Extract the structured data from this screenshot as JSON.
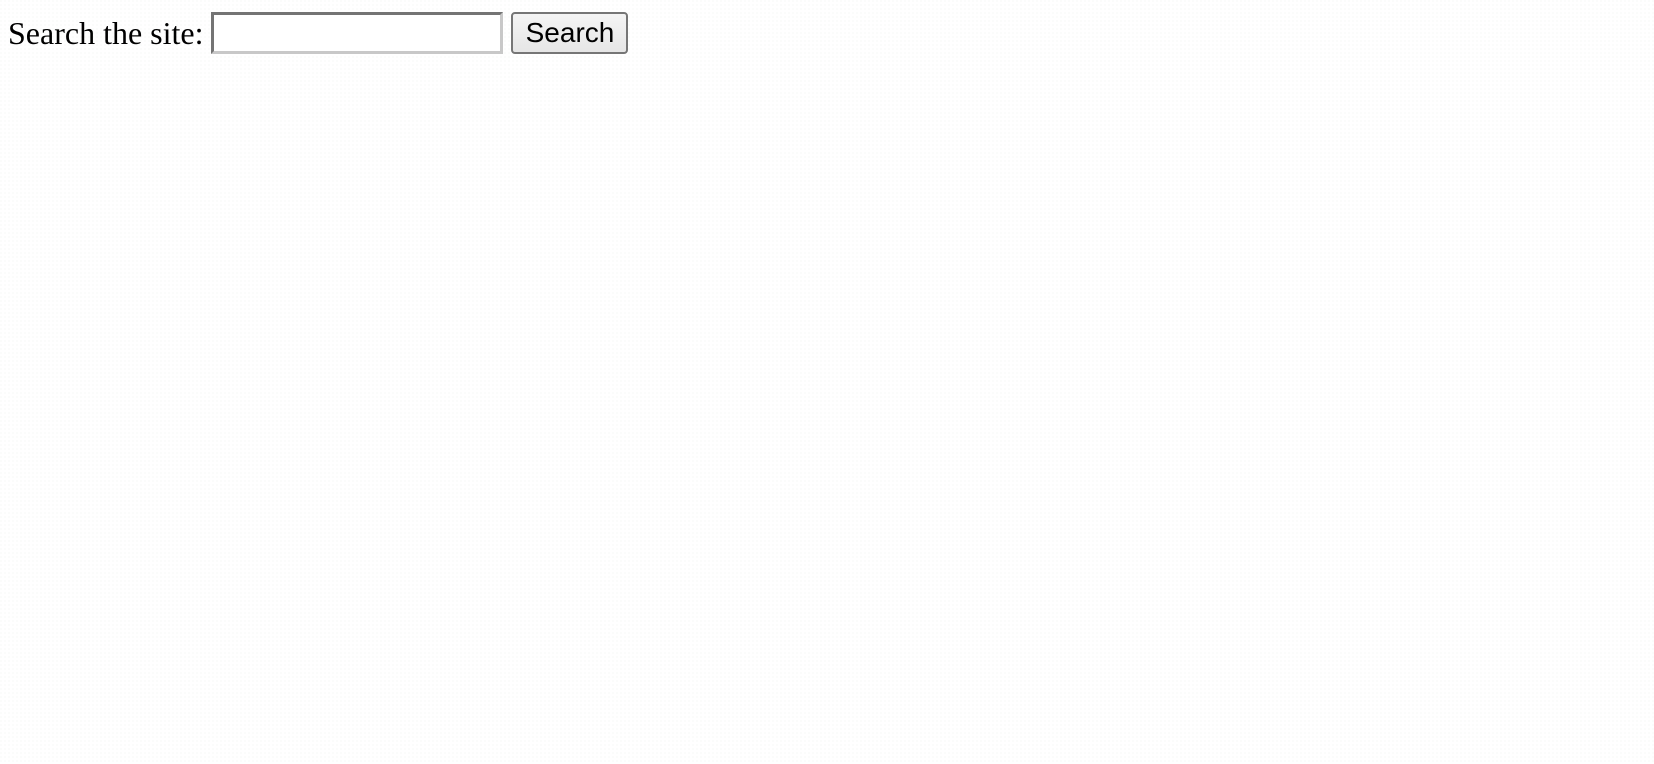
{
  "search": {
    "label": "Search the site:",
    "value": "",
    "placeholder": "",
    "button_label": "Search"
  },
  "colors": {
    "background": "#ffffff",
    "text": "#000000",
    "input_border": "#c8c8c8",
    "button_border": "#767676",
    "button_background": "#ececec"
  }
}
